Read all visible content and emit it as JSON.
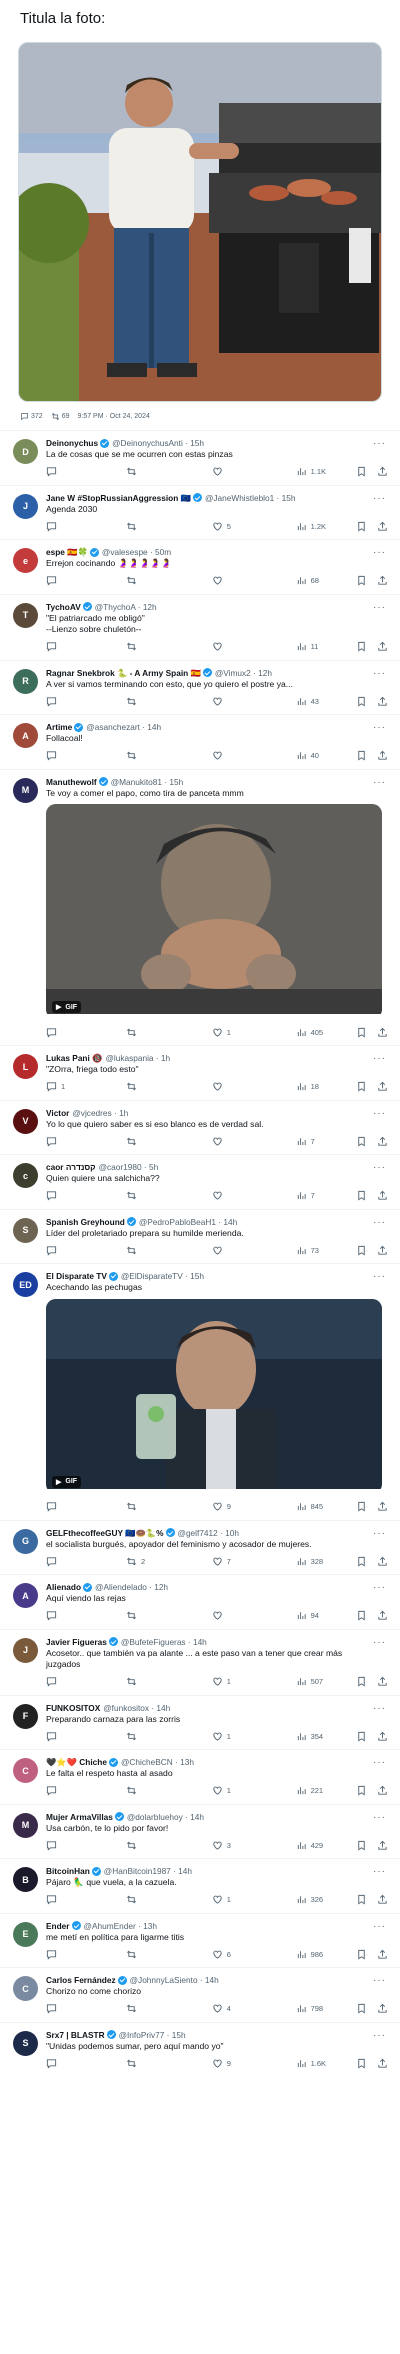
{
  "page_title": "Titula la foto:",
  "photo_alt": "Hombre en camiseta blanca asando carne en una barbacoa en una terraza",
  "stats": {
    "replies": "372",
    "retweets": "69",
    "timestamp": "9:57 PM · Oct 24, 2024"
  },
  "colors": {
    "accent": "#1d9bf0",
    "muted": "#536471",
    "border": "#eff3f4"
  },
  "tweets": [
    {
      "name": "Deinonychus",
      "handle": "@DeinonychusAnti · 15h",
      "text": "La de cosas que se me ocurren con estas pinzas",
      "views": "1.1K",
      "replies": "",
      "retweets": "",
      "likes": "",
      "verified": true,
      "avatar_color": "#7a8c5a",
      "avatar_label": "D"
    },
    {
      "name": "Jane W #StopRussianAggression 🇪🇺",
      "handle": "@JaneWhistleblo1 · 15h",
      "text": "Agenda 2030",
      "replies": "",
      "retweets": "",
      "likes": "5",
      "views": "1.2K",
      "verified": true,
      "avatar_color": "#2b5fa8",
      "avatar_label": "J"
    },
    {
      "name": "espe 🇪🇸🍀",
      "handle": "@valesespe · 50m",
      "text": "Errejon cocinando 🤰🤰🤰🤰🤰",
      "replies": "",
      "retweets": "",
      "likes": "",
      "views": "68",
      "verified": true,
      "avatar_color": "#c43b3b",
      "avatar_label": "e"
    },
    {
      "name": "TychoAV",
      "handle": "@ThychoA · 12h",
      "text": "\"El patriarcado me obligó\"\n--Lienzo sobre chuletón--",
      "replies": "",
      "retweets": "",
      "likes": "",
      "views": "11",
      "verified": true,
      "avatar_color": "#5b4a3a",
      "avatar_label": "T"
    },
    {
      "name": "Ragnar Snekbrok 🐍 - A Army Spain 🇪🇸",
      "handle": "@Vimux2 · 12h",
      "text": "A ver si vamos terminando con esto, que yo quiero el postre ya...",
      "replies": "",
      "retweets": "",
      "likes": "",
      "views": "43",
      "verified": true,
      "avatar_color": "#3c6e5b",
      "avatar_label": "R"
    },
    {
      "name": "Artime",
      "handle": "@asanchezart · 14h",
      "text": "Follacoal!",
      "replies": "",
      "retweets": "",
      "likes": "",
      "views": "40",
      "verified": true,
      "avatar_color": "#a04a3a",
      "avatar_label": "A"
    },
    {
      "name": "Manuthewolf",
      "handle": "@Manukito81 · 15h",
      "text": "Te voy a comer el papo, como tira de panceta mmm",
      "replies": "",
      "retweets": "",
      "likes": "1",
      "views": "405",
      "verified": true,
      "avatar_color": "#2a2a5a",
      "avatar_label": "M",
      "media": "gif-eating",
      "gif_label": "GIF"
    },
    {
      "name": "Lukas Pani 🔞",
      "handle": "@lukaspania · 1h",
      "text": "\"ZOrra, friega todo esto\"",
      "replies": "1",
      "retweets": "",
      "likes": "",
      "views": "18",
      "verified": false,
      "avatar_color": "#b52a2a",
      "avatar_label": "L"
    },
    {
      "name": "Victor",
      "handle": "@vjcedres · 1h",
      "text": "Yo lo que quiero saber es si eso blanco es de verdad sal.",
      "replies": "",
      "retweets": "",
      "likes": "",
      "views": "7",
      "verified": false,
      "avatar_color": "#5a1010",
      "avatar_label": "V"
    },
    {
      "name": "caor קסנדרה",
      "handle": "@caor1980 · 5h",
      "text": "Quien quiere una salchicha??",
      "replies": "",
      "retweets": "",
      "likes": "",
      "views": "7",
      "verified": false,
      "avatar_color": "#3e3e2e",
      "avatar_label": "c"
    },
    {
      "name": "Spanish Greyhound",
      "handle": "@PedroPabloBeaH1 · 14h",
      "text": "Líder del proletariado prepara su humilde merienda.",
      "replies": "",
      "retweets": "",
      "likes": "",
      "views": "73",
      "verified": true,
      "avatar_color": "#6d6452",
      "avatar_label": "S"
    },
    {
      "name": "El Disparate TV",
      "handle": "@ElDisparateTV · 15h",
      "text": "Acechando las pechugas",
      "replies": "",
      "retweets": "",
      "likes": "9",
      "views": "845",
      "verified": true,
      "avatar_color": "#1b3fa0",
      "avatar_label": "ED",
      "media": "gif-drink",
      "gif_label": "GIF"
    },
    {
      "name": "GELFthecoffeeGUY 🇪🇺🍩🐍%",
      "handle": "@gelf7412 · 10h",
      "text": "el socialista burgués, apoyador del feminismo y acosador de mujeres.",
      "replies": "",
      "retweets": "2",
      "likes": "7",
      "views": "328",
      "verified": true,
      "avatar_color": "#3a6aa0",
      "avatar_label": "G"
    },
    {
      "name": "Alienado",
      "handle": "@Aliendelado · 12h",
      "text": "Aquí viendo las rejas",
      "replies": "",
      "retweets": "",
      "likes": "",
      "views": "94",
      "verified": true,
      "avatar_color": "#4a3a8a",
      "avatar_label": "A"
    },
    {
      "name": "Javier Figueras",
      "handle": "@BufeteFigueras · 14h",
      "text": "Acosetor.. que también va pa alante ... a este paso van a tener que crear más juzgados",
      "replies": "",
      "retweets": "",
      "likes": "1",
      "views": "507",
      "verified": true,
      "avatar_color": "#7a5a3a",
      "avatar_label": "J"
    },
    {
      "name": "FUNKOSITOX",
      "handle": "@funkositox · 14h",
      "text": "Preparando carnaza para las zorris",
      "replies": "",
      "retweets": "",
      "likes": "1",
      "views": "354",
      "verified": false,
      "avatar_color": "#222222",
      "avatar_label": "F"
    },
    {
      "name": "🖤⭐❤️ Chiche",
      "handle": "@ChicheBCN · 13h",
      "text": "Le falta el respeto hasta al asado",
      "replies": "",
      "retweets": "",
      "likes": "1",
      "views": "221",
      "verified": true,
      "avatar_color": "#c06080",
      "avatar_label": "C"
    },
    {
      "name": "Mujer ArmaVillas",
      "handle": "@dolarbluehoy · 14h",
      "text": "Usa carbón, te lo pido por favor!",
      "replies": "",
      "retweets": "",
      "likes": "3",
      "views": "429",
      "verified": true,
      "avatar_color": "#3a2a4a",
      "avatar_label": "M"
    },
    {
      "name": "BitcoinHan",
      "handle": "@HanBitcoin1987 · 14h",
      "text": "Pájaro 🦜 que vuela, a la cazuela.",
      "replies": "",
      "retweets": "",
      "likes": "1",
      "views": "326",
      "verified": true,
      "avatar_color": "#1a1a2a",
      "avatar_label": "B"
    },
    {
      "name": "Ender",
      "handle": "@AhumEnder · 13h",
      "text": "me metí en política para ligarme titis",
      "replies": "",
      "retweets": "",
      "likes": "6",
      "views": "986",
      "verified": true,
      "avatar_color": "#4a7a5a",
      "avatar_label": "E"
    },
    {
      "name": "Carlos Fernández",
      "handle": "@JohnnyLaSiento · 14h",
      "text": "Chorizo no come chorizo",
      "replies": "",
      "retweets": "",
      "likes": "4",
      "views": "798",
      "verified": true,
      "avatar_color": "#7a8aa0",
      "avatar_label": "C"
    },
    {
      "name": "Srx7 | BLASTR",
      "handle": "@InfoPriv77 · 15h",
      "text": "\"Unidas podemos sumar, pero aquí mando yo\"",
      "replies": "",
      "retweets": "",
      "likes": "9",
      "views": "1.6K",
      "verified": true,
      "avatar_color": "#1d2a4a",
      "avatar_label": "S"
    }
  ]
}
